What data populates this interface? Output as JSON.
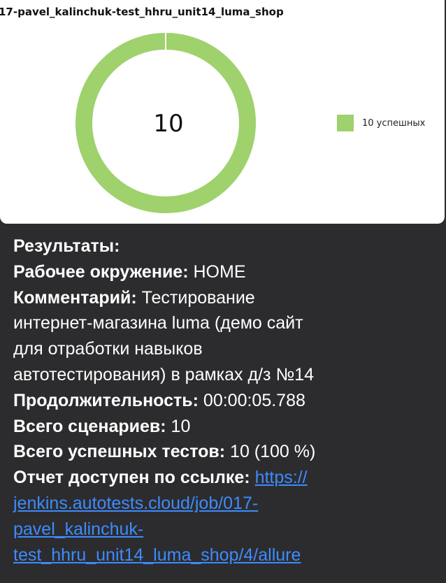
{
  "chart_card": {
    "title": "17-pavel_kalinchuk-test_hhru_unit14_luma_shop",
    "center_value": "10",
    "legend_label": "10 успешных",
    "accent_color": "#9fd16d"
  },
  "chart_data": {
    "type": "pie",
    "title": "17-pavel_kalinchuk-test_hhru_unit14_luma_shop",
    "categories": [
      "10 успешных"
    ],
    "values": [
      10
    ],
    "colors": [
      "#9fd16d"
    ],
    "donut": true,
    "center_label": "10",
    "legend_position": "right"
  },
  "message": {
    "results_heading": "Результаты:",
    "environment_label": "Рабочее окружение:",
    "environment_value": "HOME",
    "comment_label": "Комментарий:",
    "comment_line1": "Тестирование",
    "comment_line2": "интернет-магазина luma (демо сайт",
    "comment_line3": "для отработки навыков",
    "comment_line4": "автотестирования) в рамках д/з №14",
    "duration_label": "Продолжительность:",
    "duration_value": "00:00:05.788",
    "scenarios_label": "Всего сценариев:",
    "scenarios_value": "10",
    "passed_label": "Всего успешных тестов:",
    "passed_value": "10 (100 %)",
    "report_label": "Отчет доступен по ссылке:",
    "report_link_line1": "https://",
    "report_link_line2": "jenkins.autotests.cloud/job/017-",
    "report_link_line3": "pavel_kalinchuk-",
    "report_link_line4": "test_hhru_unit14_luma_shop/4/allure",
    "link_color": "#3d8bff"
  }
}
